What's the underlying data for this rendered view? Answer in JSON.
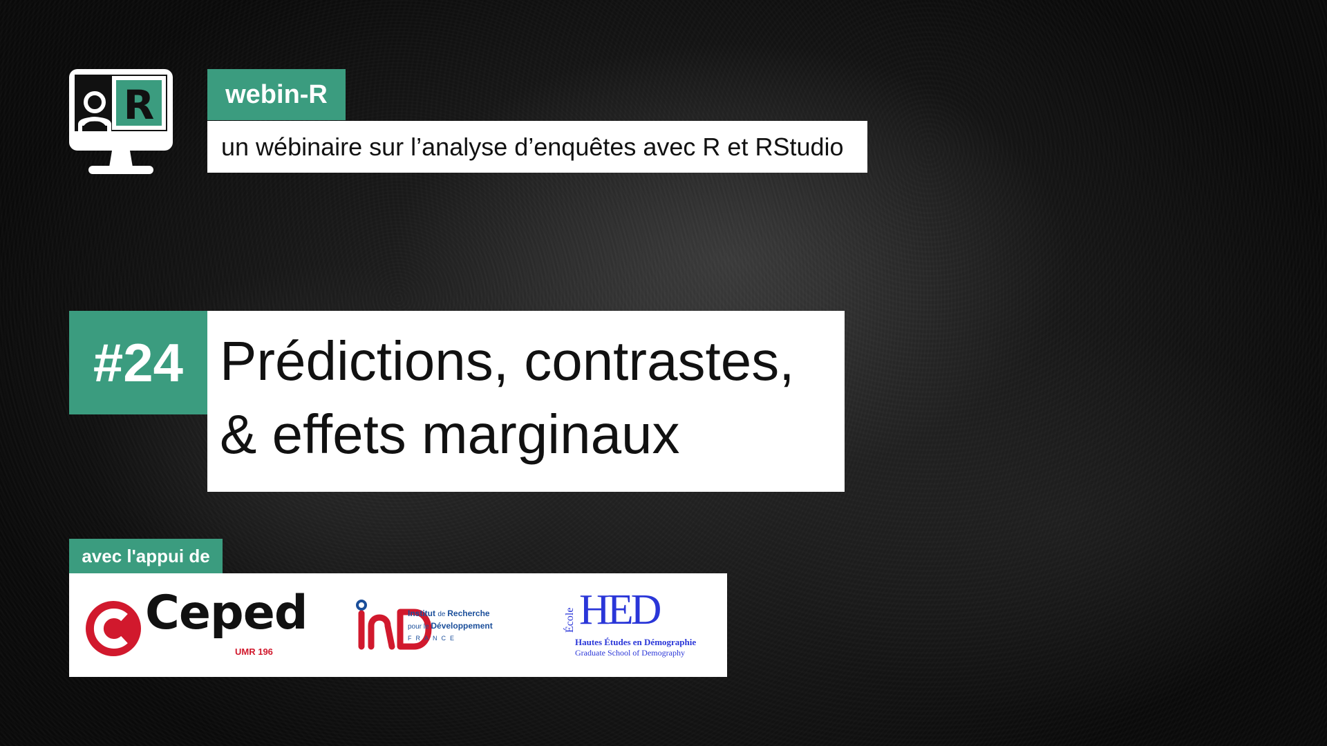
{
  "header": {
    "brand": "webin-R",
    "subtitle": "un wébinaire sur l’analyse d’enquêtes avec R et RStudio"
  },
  "episode": {
    "number": "#24",
    "title_line1": "Prédictions, contrastes,",
    "title_line2": "& effets marginaux"
  },
  "support": {
    "label": "avec l'appui de",
    "partners": {
      "ceped": {
        "name": "Ceped",
        "umr": "UMR 196"
      },
      "ird": {
        "line1_prefix": "Institut ",
        "line1_small": "de ",
        "line1_suffix": "Recherche",
        "line2_small": "pour le ",
        "line2_suffix": "Développement",
        "country": "FRANCE"
      },
      "hed": {
        "ecole": "École",
        "acronym": "HED",
        "line1": "Hautes Études en Démographie",
        "line2": "Graduate School of Demography"
      }
    }
  },
  "colors": {
    "accent": "#3b9c7f",
    "ceped_red": "#d1192d",
    "ird_blue": "#1a4e9a",
    "hed_blue": "#2a36d8"
  },
  "icons": {
    "app_logo": "monitor-person-r-icon"
  }
}
